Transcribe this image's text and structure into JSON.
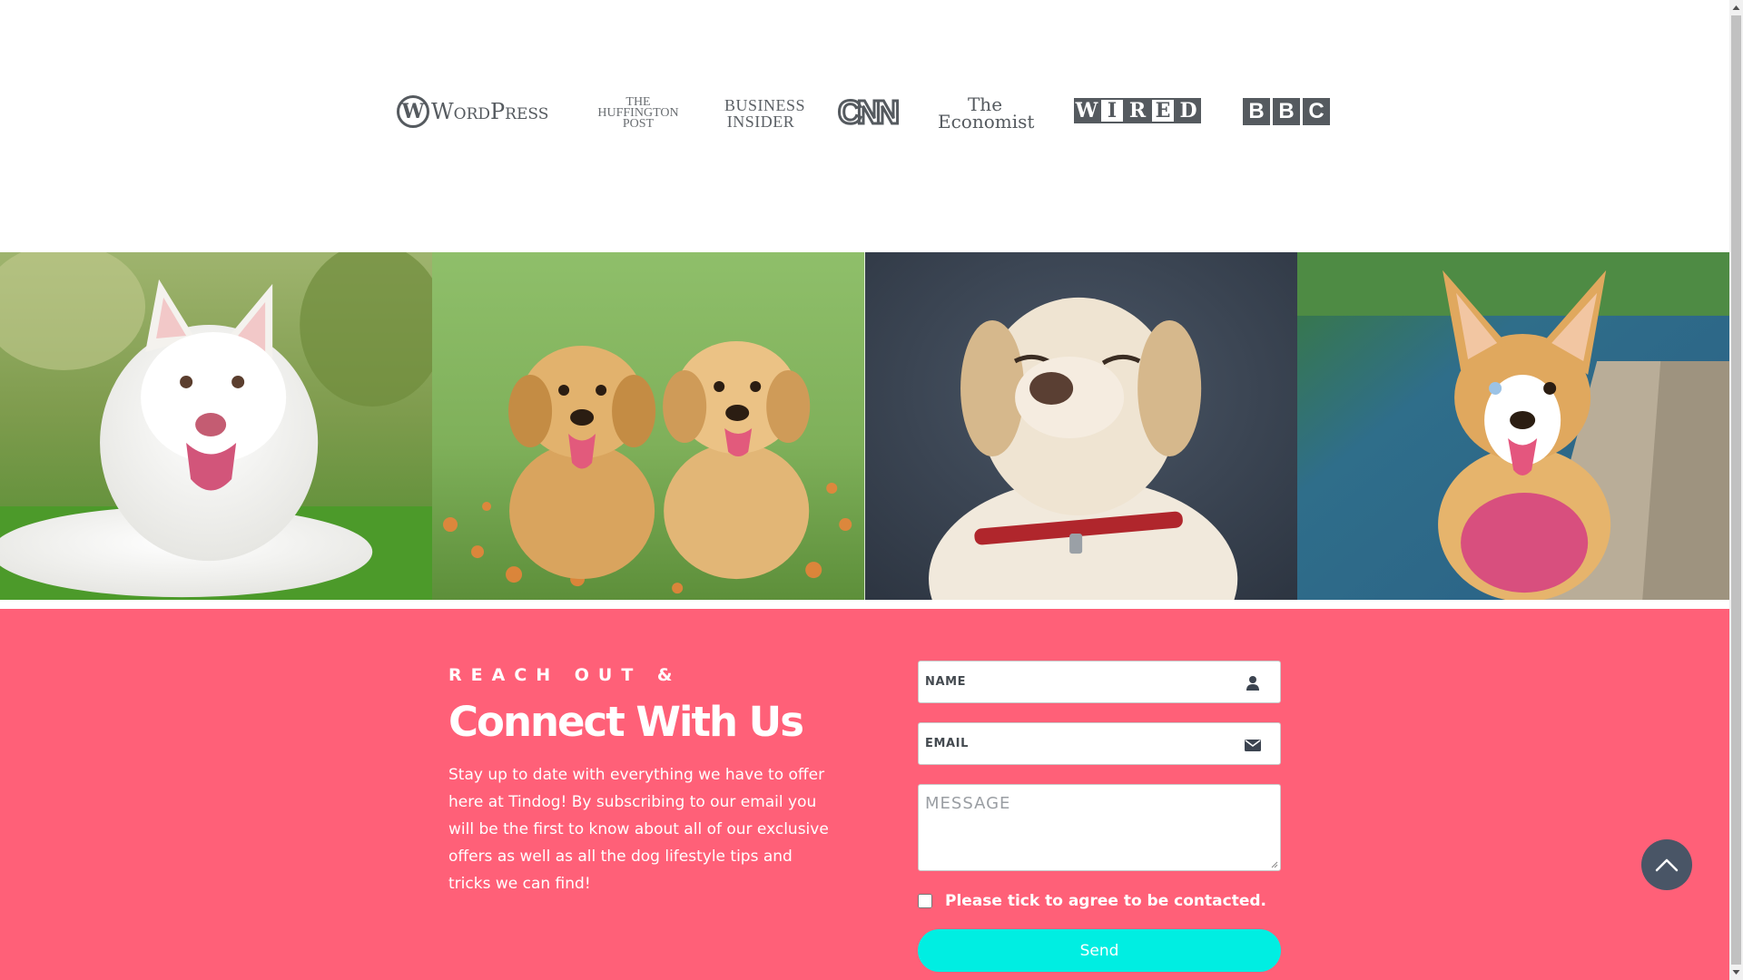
{
  "press": {
    "logos": [
      {
        "id": "wordpress",
        "mark": "W",
        "text": "WordPress"
      },
      {
        "id": "huffington",
        "lines": [
          "THE",
          "HUFFINGTON",
          "POST"
        ]
      },
      {
        "id": "business-insider",
        "lines": [
          "BUSINESS",
          "INSIDER"
        ]
      },
      {
        "id": "cnn",
        "text": "CNN"
      },
      {
        "id": "economist",
        "lines": [
          "The",
          "Economist"
        ]
      },
      {
        "id": "wired",
        "letters": [
          "W",
          "I",
          "R",
          "E",
          "D"
        ]
      },
      {
        "id": "bbc",
        "letters": [
          "B",
          "B",
          "C"
        ]
      }
    ]
  },
  "gallery": {
    "images": [
      {
        "subject": "white fluffy dog lying on grass"
      },
      {
        "subject": "two golden retriever puppies in flowers"
      },
      {
        "subject": "labrador with eyes closed on dark background"
      },
      {
        "subject": "corgi walking by a pool"
      }
    ]
  },
  "contact": {
    "eyebrow": "REACH OUT &",
    "headline": "Connect With Us",
    "blurb": "Stay up to date with everything we have to offer here at Tindog! By subscribing to our email you will be the first to know about all of our exclusive offers as well as all the dog lifestyle tips and tricks we can find!",
    "name_placeholder": "NAME",
    "email_placeholder": "EMAIL",
    "message_placeholder": "MESSAGE",
    "consent_label": "Please tick to agree to be contacted.",
    "send_label": "Send"
  },
  "colors": {
    "section_bg": "#ff6078",
    "button_bg": "#00eee2",
    "logo_gray": "#555a5f",
    "scroll_top_bg": "#495566"
  },
  "icons": {
    "name_field": "user-icon",
    "email_field": "envelope-icon",
    "scroll_top": "chevron-up-icon"
  }
}
